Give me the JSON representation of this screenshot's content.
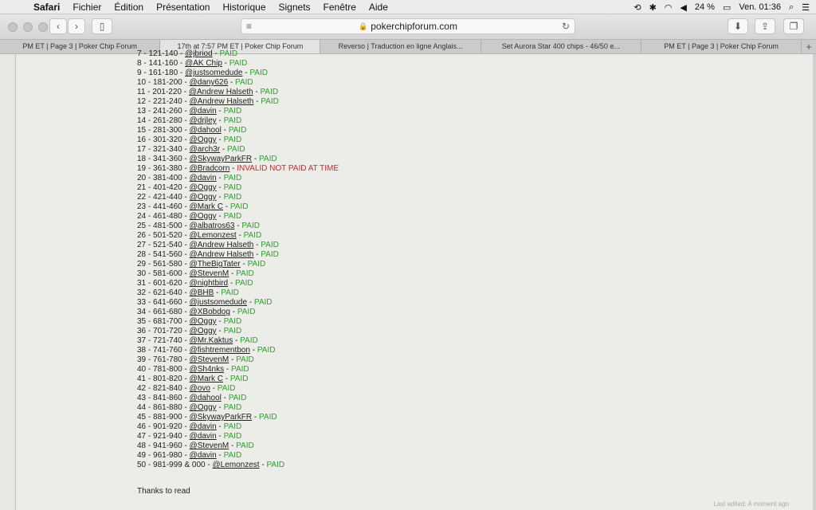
{
  "menubar": {
    "app": "Safari",
    "items": [
      "Fichier",
      "Édition",
      "Présentation",
      "Historique",
      "Signets",
      "Fenêtre",
      "Aide"
    ],
    "battery": "24 %",
    "clock": "Ven. 01:36"
  },
  "toolbar": {
    "url": "pokerchipforum.com"
  },
  "tabs": [
    "PM ET | Page 3 | Poker Chip Forum",
    "17th at 7:57 PM ET | Poker Chip Forum",
    "Reverso | Traduction en ligne Anglais...",
    "Set Aurora Star 400 chips - 46/50 e...",
    "PM ET | Page 3 | Poker Chip Forum"
  ],
  "rows": [
    {
      "num": "7 - 121-140 - ",
      "user": "@jbriod",
      "status": "PAID",
      "kind": "paid"
    },
    {
      "num": "8 - 141-160 - ",
      "user": "@AK Chip",
      "status": "PAID",
      "kind": "paid"
    },
    {
      "num": "9 - 161-180 - ",
      "user": "@justsomedude",
      "status": "PAID",
      "kind": "paid"
    },
    {
      "num": "10 - 181-200 - ",
      "user": "@dany626",
      "status": "PAID",
      "kind": "paid"
    },
    {
      "num": "11 - 201-220 - ",
      "user": "@Andrew Halseth",
      "status": "PAID",
      "kind": "paid"
    },
    {
      "num": "12 - 221-240 - ",
      "user": "@Andrew Halseth",
      "status": "PAID",
      "kind": "paid"
    },
    {
      "num": "13 - 241-260 - ",
      "user": "@davin",
      "status": "PAID",
      "kind": "paid"
    },
    {
      "num": "14 - 261-280 - ",
      "user": "@drjley",
      "status": "PAID",
      "kind": "paid"
    },
    {
      "num": "15 - 281-300 - ",
      "user": "@dahool",
      "status": "PAID",
      "kind": "paid"
    },
    {
      "num": "16 - 301-320 - ",
      "user": "@Oggy",
      "status": "PAID",
      "kind": "paid"
    },
    {
      "num": "17 - 321-340 - ",
      "user": "@arch3r",
      "status": "PAID",
      "kind": "paid"
    },
    {
      "num": "18 - 341-360 - ",
      "user": "@SkywayParkFR",
      "status": "PAID",
      "kind": "paid"
    },
    {
      "num": "19 - 361-380 - ",
      "user": "@Bradcorn",
      "status": "INVALID NOT PAID AT TIME",
      "kind": "invalid"
    },
    {
      "num": "20 - 381-400 - ",
      "user": "@davin",
      "status": "PAID",
      "kind": "paid"
    },
    {
      "num": "21 - 401-420 - ",
      "user": "@Oggy",
      "status": "PAID",
      "kind": "paid"
    },
    {
      "num": "22 - 421-440 - ",
      "user": "@Oggy",
      "status": "PAID",
      "kind": "paid"
    },
    {
      "num": "23 - 441-460 - ",
      "user": "@Mark C",
      "status": "PAID",
      "kind": "paid"
    },
    {
      "num": "24 - 461-480 - ",
      "user": "@Oggy",
      "status": "PAID",
      "kind": "paid"
    },
    {
      "num": "25 - 481-500 - ",
      "user": "@albatros63",
      "status": "PAID",
      "kind": "paid"
    },
    {
      "num": "26 - 501-520 - ",
      "user": "@Lemonzest",
      "status": "PAID",
      "kind": "paid"
    },
    {
      "num": "27 - 521-540 - ",
      "user": "@Andrew Halseth",
      "status": "PAID",
      "kind": "paid"
    },
    {
      "num": "28 - 541-560 - ",
      "user": "@Andrew Halseth",
      "status": "PAID",
      "kind": "paid"
    },
    {
      "num": "29 - 561-580 - ",
      "user": "@TheBigTater",
      "status": "PAID",
      "kind": "paid"
    },
    {
      "num": "30 - 581-600 - ",
      "user": "@StevenM",
      "status": "PAID",
      "kind": "paid"
    },
    {
      "num": "31 - 601-620 - ",
      "user": "@nightbird",
      "status": "PAID",
      "kind": "paid"
    },
    {
      "num": "32 - 621-640 - ",
      "user": "@BHB",
      "status": "PAID",
      "kind": "paid"
    },
    {
      "num": "33 - 641-660 - ",
      "user": "@justsomedude",
      "status": "PAID",
      "kind": "paid"
    },
    {
      "num": "34 - 661-680 - ",
      "user": "@XBobdog",
      "status": "PAID",
      "kind": "paid"
    },
    {
      "num": "35 - 681-700 - ",
      "user": "@Oggy",
      "status": "PAID",
      "kind": "paid"
    },
    {
      "num": "36 - 701-720 - ",
      "user": "@Oggy",
      "status": "PAID",
      "kind": "paid"
    },
    {
      "num": "37 - 721-740 - ",
      "user": "@Mr.Kaktus",
      "status": "PAID",
      "kind": "paid"
    },
    {
      "num": "38 - 741-760 - ",
      "user": "@fishtrementbon",
      "status": "PAID",
      "kind": "paid"
    },
    {
      "num": "39 - 761-780 - ",
      "user": "@StevenM",
      "status": "PAID",
      "kind": "paid"
    },
    {
      "num": "40 - 781-800 - ",
      "user": "@Sh4nks",
      "status": "PAID",
      "kind": "paid"
    },
    {
      "num": "41 - 801-820 - ",
      "user": "@Mark C",
      "status": "PAID",
      "kind": "paid"
    },
    {
      "num": "42 - 821-840 - ",
      "user": "@ovo",
      "status": "PAID",
      "kind": "paid"
    },
    {
      "num": "43 - 841-860 - ",
      "user": "@dahool",
      "status": "PAID",
      "kind": "paid"
    },
    {
      "num": "44 - 861-880 - ",
      "user": "@Oggy",
      "status": "PAID",
      "kind": "paid"
    },
    {
      "num": "45 - 881-900 - ",
      "user": "@SkywayParkFR",
      "status": "PAID",
      "kind": "paid"
    },
    {
      "num": "46 - 901-920 - ",
      "user": "@davin",
      "status": "PAID",
      "kind": "paid"
    },
    {
      "num": "47 - 921-940 - ",
      "user": "@davin",
      "status": "PAID",
      "kind": "paid"
    },
    {
      "num": "48 - 941-960 - ",
      "user": "@StevenM",
      "status": "PAID",
      "kind": "paid"
    },
    {
      "num": "49 - 961-980 - ",
      "user": "@davin",
      "status": "PAID",
      "kind": "paid"
    },
    {
      "num": "50 - 981-999 & 000 - ",
      "user": "@Lemonzest",
      "status": "PAID",
      "kind": "paid"
    }
  ],
  "thanks": "Thanks to read",
  "edited": "Last edited: A moment ago"
}
